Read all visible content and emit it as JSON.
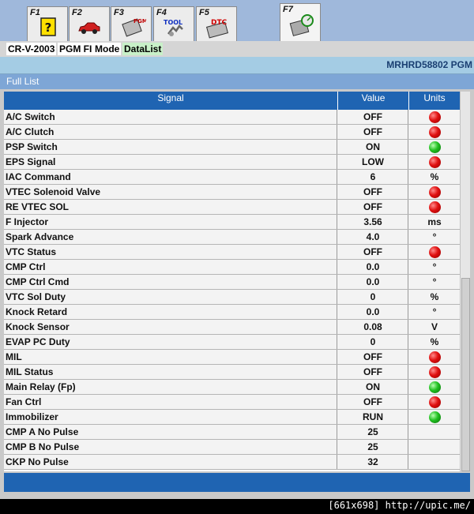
{
  "toolbar": {
    "keys": [
      {
        "label": "F1",
        "icon": "help-icon"
      },
      {
        "label": "F2",
        "icon": "car-icon"
      },
      {
        "label": "F3",
        "icon": "pgm-icon",
        "icon_text": "PGM"
      },
      {
        "label": "F4",
        "icon": "tool-icon",
        "icon_text": "TOOL"
      },
      {
        "label": "F5",
        "icon": "dtc-icon",
        "icon_text": "DTC"
      },
      {
        "label": "F7",
        "icon": "datalist-icon"
      }
    ]
  },
  "modebar": {
    "vehicle": "CR-V-2003",
    "system": "PGM FI",
    "mode_label": "Mode",
    "mode_value": "DataList"
  },
  "ecu_id": "MRHRD58802  PGM",
  "list_title": "Full List",
  "table": {
    "headers": [
      "Signal",
      "Value",
      "Units"
    ],
    "rows": [
      {
        "signal": "A/C Switch",
        "value": "OFF",
        "unit": "",
        "led": "red"
      },
      {
        "signal": "A/C Clutch",
        "value": "OFF",
        "unit": "",
        "led": "red"
      },
      {
        "signal": "PSP Switch",
        "value": "ON",
        "unit": "",
        "led": "green"
      },
      {
        "signal": "EPS Signal",
        "value": "LOW",
        "unit": "",
        "led": "red"
      },
      {
        "signal": "IAC Command",
        "value": "6",
        "unit": "%",
        "led": ""
      },
      {
        "signal": "VTEC Solenoid Valve",
        "value": "OFF",
        "unit": "",
        "led": "red"
      },
      {
        "signal": "RE VTEC SOL",
        "value": "OFF",
        "unit": "",
        "led": "red"
      },
      {
        "signal": "F Injector",
        "value": "3.56",
        "unit": "ms",
        "led": ""
      },
      {
        "signal": "Spark Advance",
        "value": "4.0",
        "unit": "°",
        "led": ""
      },
      {
        "signal": "VTC Status",
        "value": "OFF",
        "unit": "",
        "led": "red"
      },
      {
        "signal": "CMP Ctrl",
        "value": "0.0",
        "unit": "°",
        "led": ""
      },
      {
        "signal": "CMP Ctrl Cmd",
        "value": "0.0",
        "unit": "°",
        "led": ""
      },
      {
        "signal": "VTC Sol Duty",
        "value": "0",
        "unit": "%",
        "led": ""
      },
      {
        "signal": "Knock Retard",
        "value": "0.0",
        "unit": "°",
        "led": ""
      },
      {
        "signal": "Knock Sensor",
        "value": "0.08",
        "unit": "V",
        "led": ""
      },
      {
        "signal": "EVAP PC Duty",
        "value": "0",
        "unit": "%",
        "led": ""
      },
      {
        "signal": "MIL",
        "value": "OFF",
        "unit": "",
        "led": "red"
      },
      {
        "signal": "MIL Status",
        "value": "OFF",
        "unit": "",
        "led": "red"
      },
      {
        "signal": "Main Relay (Fp)",
        "value": "ON",
        "unit": "",
        "led": "green"
      },
      {
        "signal": "Fan Ctrl",
        "value": "OFF",
        "unit": "",
        "led": "red"
      },
      {
        "signal": "Immobilizer",
        "value": "RUN",
        "unit": "",
        "led": "green"
      },
      {
        "signal": "CMP A No Pulse",
        "value": "25",
        "unit": "",
        "led": ""
      },
      {
        "signal": "CMP B No Pulse",
        "value": "25",
        "unit": "",
        "led": ""
      },
      {
        "signal": "CKP No Pulse",
        "value": "32",
        "unit": "",
        "led": ""
      }
    ]
  },
  "watermark": "[661x698] http://upic.me/",
  "colors": {
    "header_blue": "#1f64b2",
    "led_red": "#e01010",
    "led_green": "#20c020"
  }
}
